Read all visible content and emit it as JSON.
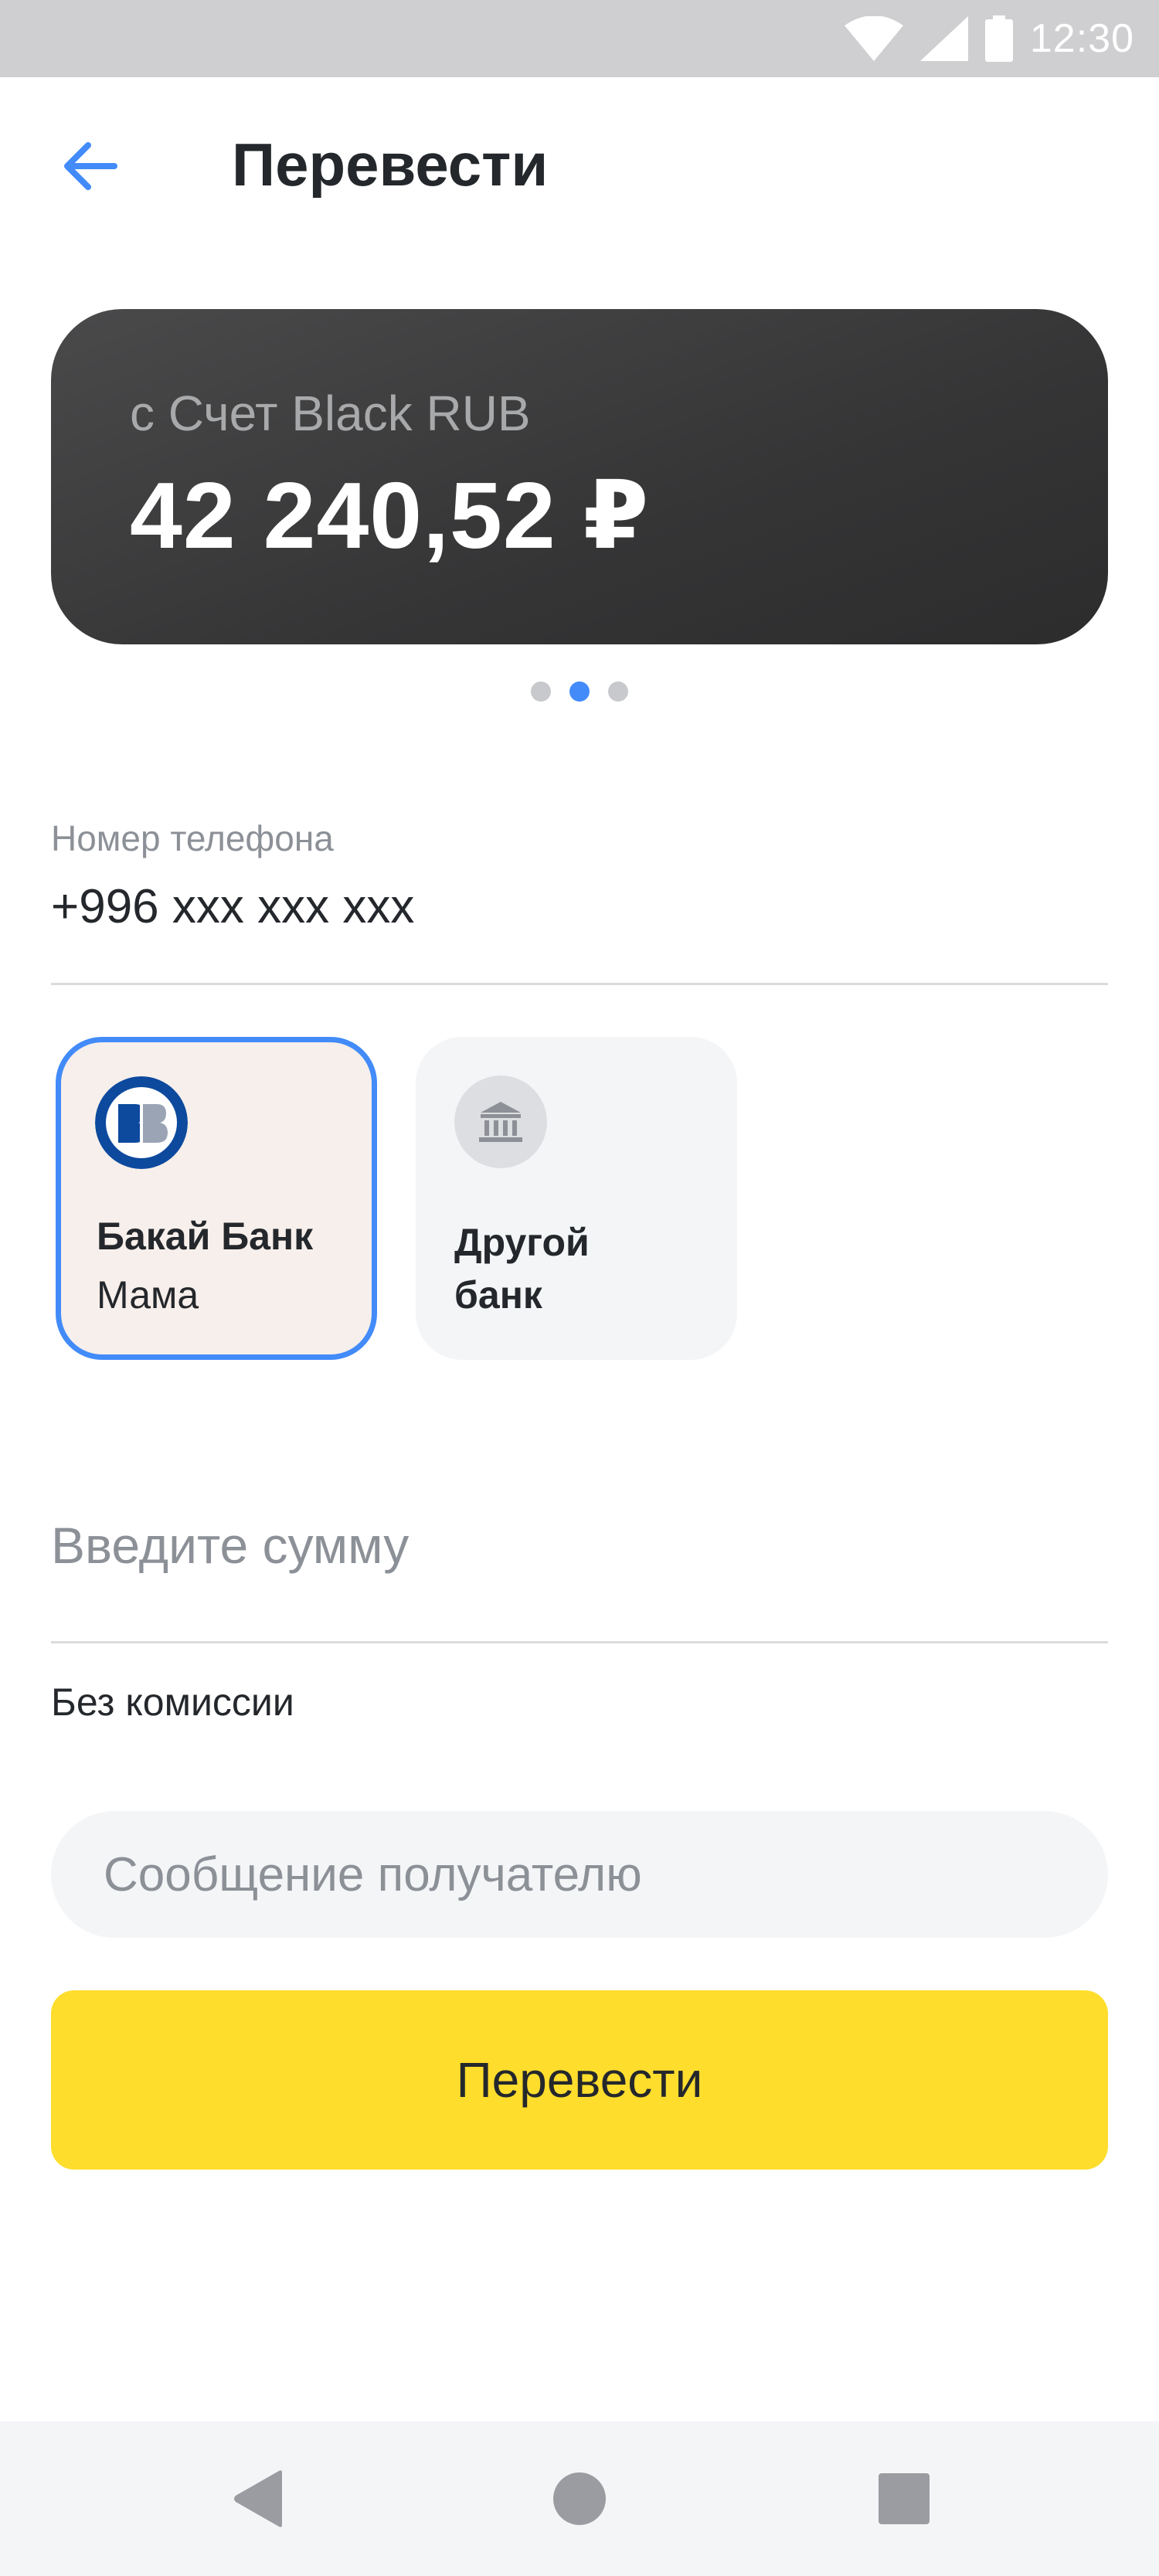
{
  "status_bar": {
    "time": "12:30",
    "icons": [
      "wifi-icon",
      "signal-icon",
      "battery-icon"
    ]
  },
  "header": {
    "title": "Перевести",
    "back_icon": "arrow-left-icon"
  },
  "account_card": {
    "name": "с Счет Black RUB",
    "balance": "42 240,52 ₽",
    "pager": {
      "count": 3,
      "active_index": 1
    }
  },
  "phone": {
    "label": "Номер телефона",
    "value": "+996 xxx xxx xxx"
  },
  "banks": [
    {
      "name": "Бакай Банк",
      "subtitle": "Мама",
      "selected": true,
      "icon": "bakai-bank-logo"
    },
    {
      "name": "Другой банк",
      "subtitle": "",
      "selected": false,
      "icon": "bank-building-icon"
    }
  ],
  "amount": {
    "placeholder": "Введите сумму",
    "value": ""
  },
  "commission_text": "Без комиссии",
  "message": {
    "placeholder": "Сообщение получателю",
    "value": ""
  },
  "submit_label": "Перевести",
  "nav_bar": {
    "icons": [
      "back-triangle-icon",
      "home-circle-icon",
      "recents-square-icon"
    ]
  },
  "colors": {
    "accent_blue": "#428bf9",
    "button_yellow": "#ffdd2d",
    "card_dark": "#363637",
    "selected_bank_bg": "#f7efeb",
    "muted_text": "#8c9097"
  }
}
